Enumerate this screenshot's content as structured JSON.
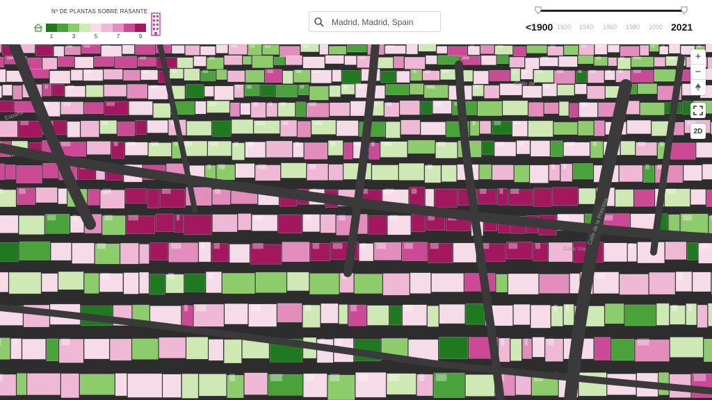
{
  "legend": {
    "title": "Nº DE PLANTAS SOBRE RASANTE",
    "colors": [
      "#1f7a1f",
      "#4aa33a",
      "#8ccc6a",
      "#cfe9b4",
      "#f6dbe9",
      "#efb8d4",
      "#e38dbd",
      "#cc4a95",
      "#a3175f"
    ],
    "labels": [
      {
        "text": "1",
        "slot": 0
      },
      {
        "text": "3",
        "slot": 2
      },
      {
        "text": "5",
        "slot": 4
      },
      {
        "text": "7",
        "slot": 6
      },
      {
        "text": "9",
        "slot": 8
      }
    ],
    "low_icon": "low-building-icon",
    "high_icon": "tall-building-icon"
  },
  "search": {
    "icon": "search-icon",
    "value": "Madrid, Madrid, Spain"
  },
  "timeline": {
    "start_label": "<1900",
    "end_label": "2021",
    "ticks": [
      "1920",
      "1940",
      "1960",
      "1980",
      "2000"
    ],
    "range": [
      1900,
      2021
    ]
  },
  "map_controls": {
    "zoom_in": "+",
    "zoom_out": "−",
    "compass_icon": "compass-icon",
    "fullscreen_icon": "fullscreen-icon",
    "view_mode": "2D"
  },
  "street_labels": [
    "España",
    "Calle de",
    "Gran Vía",
    "Calle de la Princesa"
  ]
}
